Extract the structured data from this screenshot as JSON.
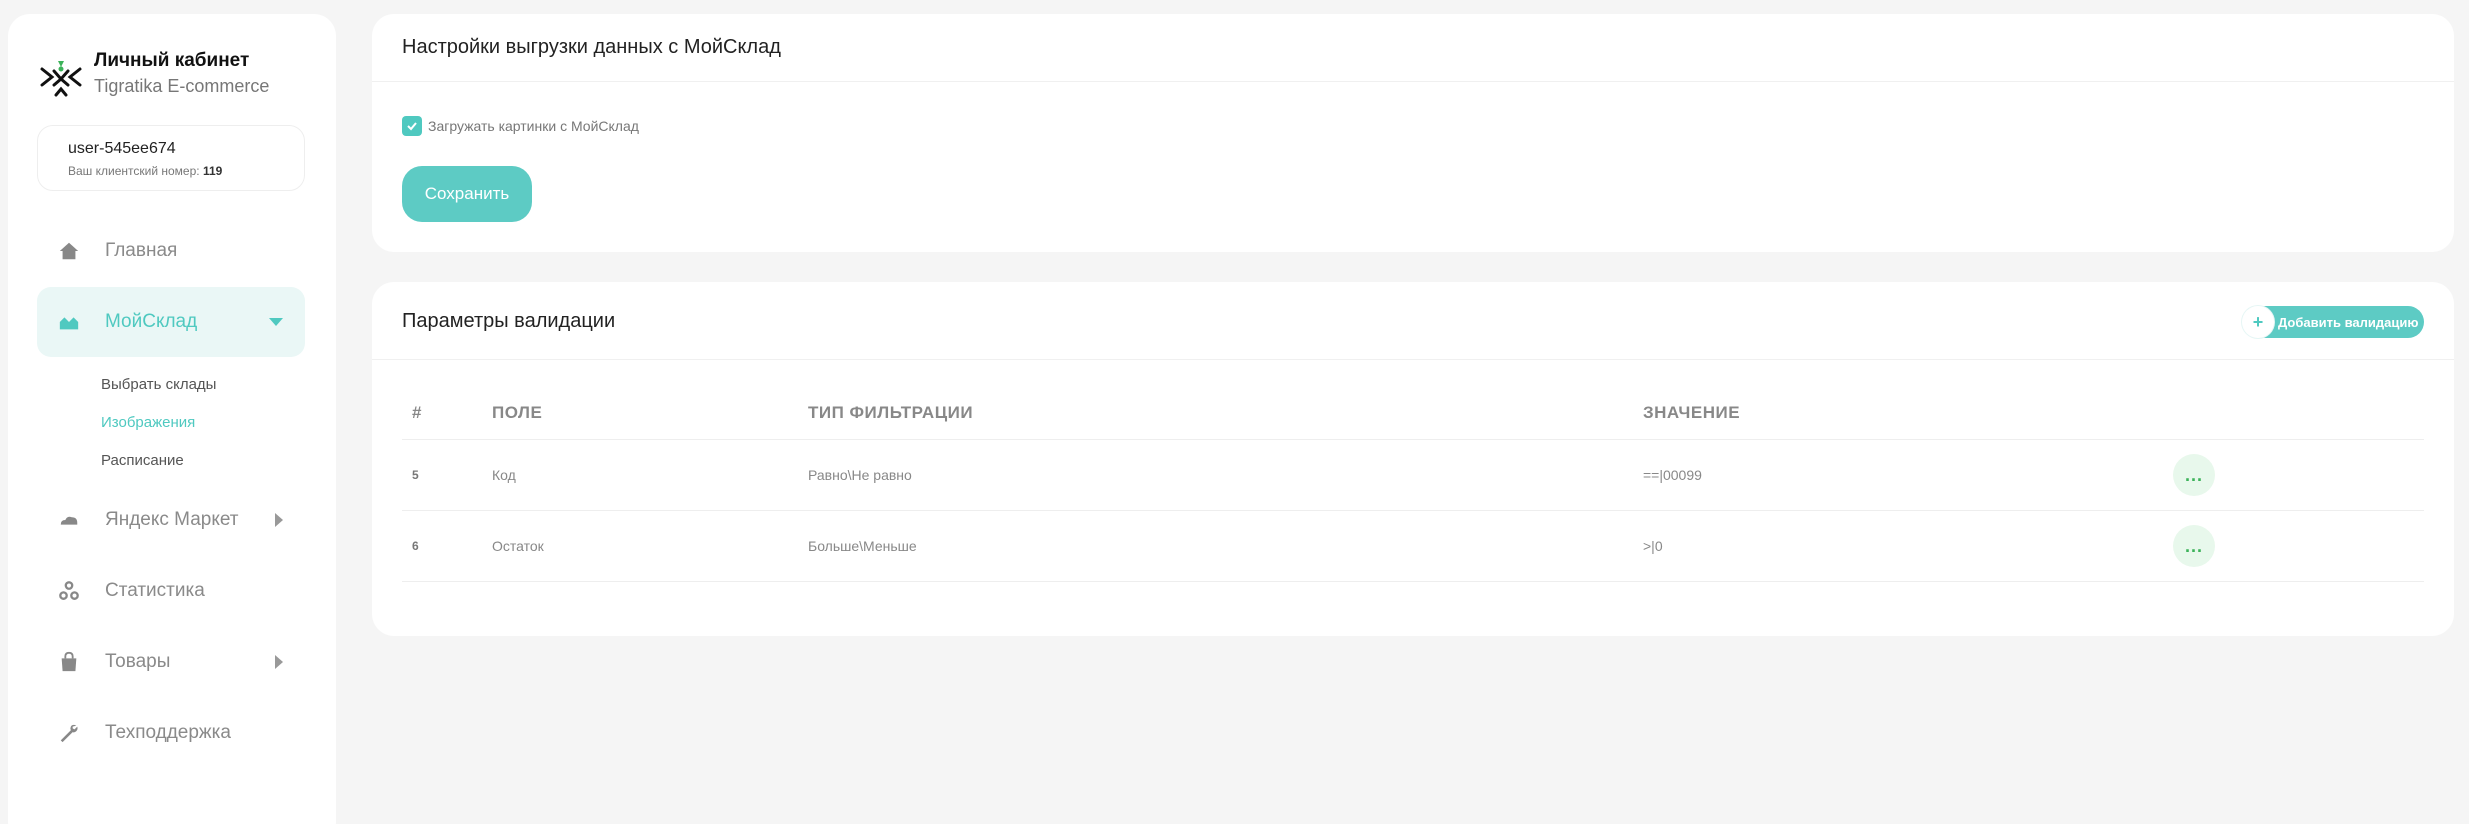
{
  "sidebar": {
    "brand_title": "Личный кабинет",
    "brand_subtitle": "Tigratika E-commerce",
    "user": {
      "name": "user-545ee674",
      "client_label": "Ваш клиентский номер:",
      "client_number": "119"
    },
    "nav": [
      {
        "label": "Главная",
        "icon": "home-icon"
      },
      {
        "label": "МойСклад",
        "icon": "warehouse-icon"
      },
      {
        "label": "Яндекс Маркет",
        "icon": "cloud-icon"
      },
      {
        "label": "Статистика",
        "icon": "stats-icon"
      },
      {
        "label": "Товары",
        "icon": "bag-icon"
      },
      {
        "label": "Техподдержка",
        "icon": "wrench-icon"
      }
    ],
    "subnav": [
      {
        "label": "Выбрать склады"
      },
      {
        "label": "Изображения"
      },
      {
        "label": "Расписание"
      }
    ]
  },
  "export_settings": {
    "title": "Настройки выгрузки данных с МойСклад",
    "checkbox_label": "Загружать картинки с МойСклад",
    "checkbox_checked": true,
    "save_label": "Сохранить"
  },
  "validation": {
    "title": "Параметры валидации",
    "add_label": "Добавить валидацию",
    "add_icon": "+",
    "columns": [
      "#",
      "ПОЛЕ",
      "ТИП ФИЛЬТРАЦИИ",
      "ЗНАЧЕНИЕ"
    ],
    "rows": [
      {
        "num": "5",
        "field": "Код",
        "type": "Равно\\Не равно",
        "value": "==|00099",
        "action": "..."
      },
      {
        "num": "6",
        "field": "Остаток",
        "type": "Больше\\Меньше",
        "value": ">|0",
        "action": "..."
      }
    ]
  },
  "colors": {
    "accent": "#4fc9c0",
    "accent_bg": "#eaf7f6",
    "action_bg": "#e8f8ec",
    "background": "#f5f5f5"
  }
}
